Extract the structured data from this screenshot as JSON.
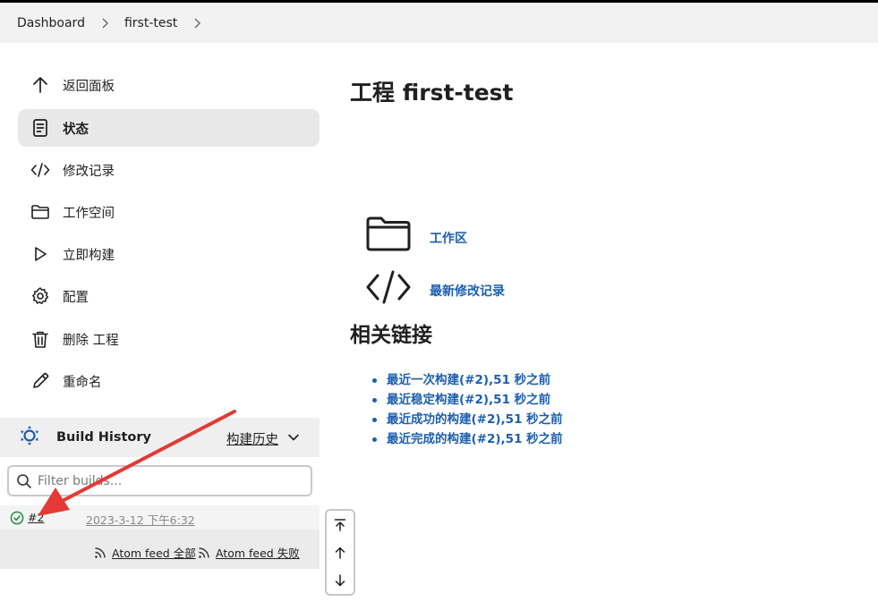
{
  "breadcrumb": {
    "items": [
      "Dashboard",
      "first-test"
    ]
  },
  "sidebar": {
    "items": [
      {
        "label": "返回面板",
        "icon": "arrow-up-icon"
      },
      {
        "label": "状态",
        "icon": "document-icon",
        "active": true
      },
      {
        "label": "修改记录",
        "icon": "code-icon"
      },
      {
        "label": "工作空间",
        "icon": "folder-icon"
      },
      {
        "label": "立即构建",
        "icon": "play-icon"
      },
      {
        "label": "配置",
        "icon": "gear-icon"
      },
      {
        "label": "删除 工程",
        "icon": "trash-icon"
      },
      {
        "label": "重命名",
        "icon": "pencil-icon"
      }
    ]
  },
  "build_history": {
    "title": "Build History",
    "trend_label": "构建历史",
    "filter_placeholder": "Filter builds...",
    "builds": [
      {
        "number": "#2",
        "time": "2023-3-12 下午6:32",
        "status": "success"
      }
    ],
    "feed_all": "Atom feed 全部",
    "feed_fail": "Atom feed 失败"
  },
  "main": {
    "title": "工程 first-test",
    "links": [
      {
        "label": "工作区",
        "icon": "folder-icon"
      },
      {
        "label": "最新修改记录",
        "icon": "code-icon"
      }
    ],
    "related_title": "相关链接",
    "related_links": [
      "最近一次构建(#2),51 秒之前",
      "最近稳定构建(#2),51 秒之前",
      "最近成功的构建(#2),51 秒之前",
      "最近完成的构建(#2),51 秒之前"
    ]
  },
  "colors": {
    "link": "#1b5fb0",
    "success": "#1e8e3e",
    "annotation_arrow": "#e53935",
    "active_bg": "#e8e8e9"
  }
}
